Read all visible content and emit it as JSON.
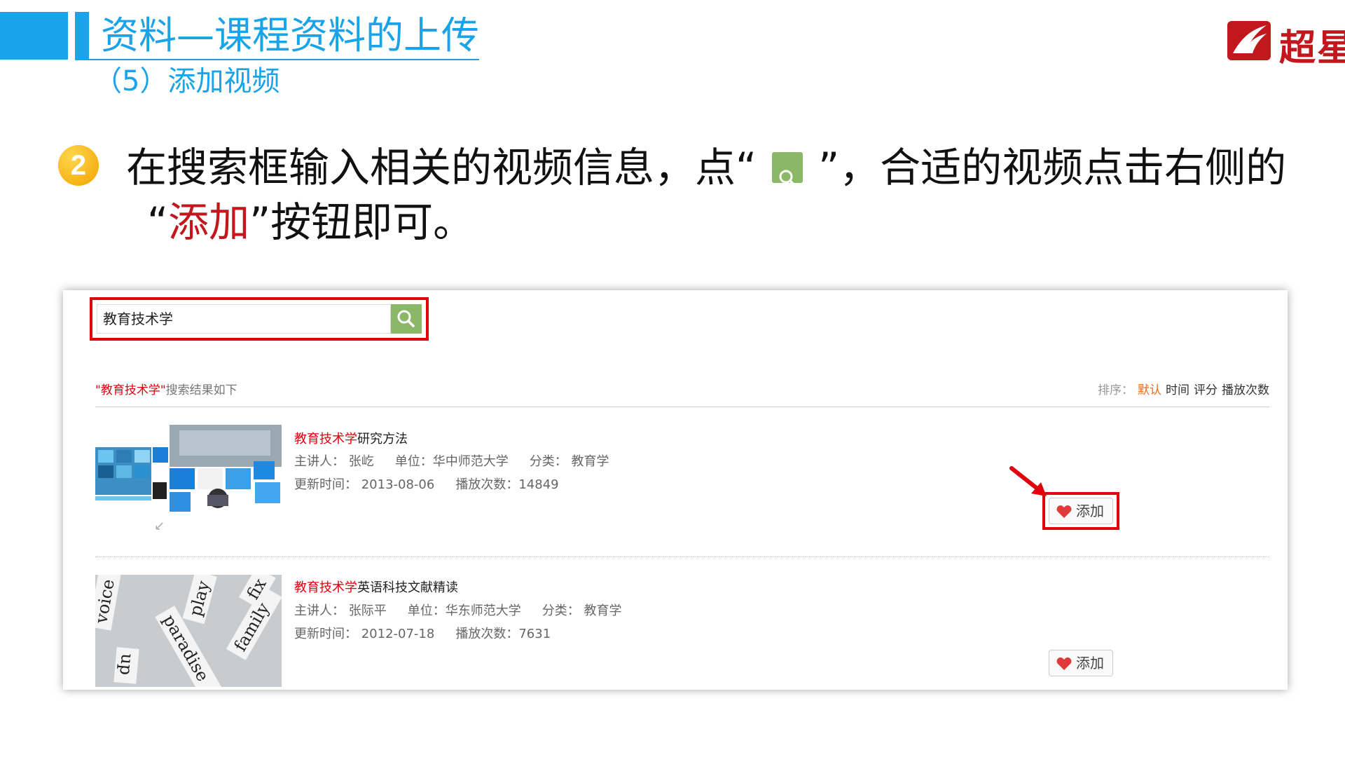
{
  "slide": {
    "title": "资料—课程资料的上传",
    "subtitle": "（5）添加视频",
    "logo_text": "超星",
    "step_number": "2",
    "instruction_part1": "在搜索框输入相关的视频信息，点“",
    "instruction_part2": "”，合适的视频点击右侧的",
    "instruction_line2_open": "“",
    "instruction_line2_red": "添加",
    "instruction_line2_close": "”按钮即可。"
  },
  "colors": {
    "title_blue": "#1aa3e8",
    "highlight_red": "#e0000e",
    "search_green": "#8ab867",
    "keyword_red": "#e0000e",
    "sort_active": "#f26a1a"
  },
  "search": {
    "query": "教育技术学",
    "button_icon": "search-icon"
  },
  "results": {
    "header_keyword": "\"教育技术学\"",
    "header_suffix": "搜索结果如下",
    "sort_label": "排序：",
    "sort_options": [
      "默认",
      "时间",
      "评分",
      "播放次数"
    ],
    "items": [
      {
        "title_keyword": "教育技术学",
        "title_rest": "研究方法",
        "lecturer": "主讲人： 张屹",
        "unit": "单位：华中师范大学",
        "category": "分类： 教育学",
        "updated": "更新时间： 2013-08-06",
        "plays": "播放次数：14849",
        "add_label": "添加"
      },
      {
        "title_keyword": "教育技术学",
        "title_rest": "英语科技文献精读",
        "lecturer": "主讲人： 张际平",
        "unit": "单位：华东师范大学",
        "category": "分类： 教育学",
        "updated": "更新时间： 2012-07-18",
        "plays": "播放次数：7631",
        "add_label": "添加"
      }
    ]
  },
  "thumb2_words": [
    "voice",
    "play",
    "paradise",
    "family",
    "up",
    "fix"
  ]
}
